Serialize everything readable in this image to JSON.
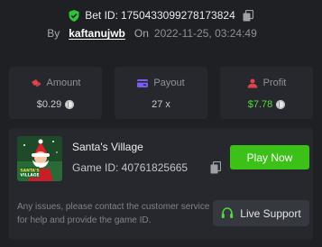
{
  "bet": {
    "id_label": "Bet ID:",
    "id_value": "1750433099278173824",
    "by_label": "By",
    "username": "kaftanujwb",
    "on_label": "On",
    "datetime": "2022-11-25, 03:24:49"
  },
  "stats": {
    "amount": {
      "label": "Amount",
      "value": "$0.29"
    },
    "payout": {
      "label": "Payout",
      "value": "27 x"
    },
    "profit": {
      "label": "Profit",
      "value": "$7.78"
    }
  },
  "game": {
    "title": "Santa's Village",
    "id_text": "Game ID: 40761825665",
    "play_label": "Play Now",
    "help_text": "Any issues, please contact the customer service for help and provide the game ID.",
    "support_label": "Live Support",
    "thumbnail_text": "SANTA'S VILLAGE"
  },
  "colors": {
    "background": "#1e2024",
    "card": "#26282d",
    "accent_green": "#3bc117",
    "profit_green": "#4fdd3a",
    "amount_icon": "#e0434b",
    "payout_icon": "#7b5cf0",
    "profit_icon": "#e0434b"
  },
  "icons": [
    "shield-check-icon",
    "copy-icon",
    "amount-icon",
    "payout-icon",
    "profit-icon",
    "coin-icon",
    "headset-icon"
  ]
}
